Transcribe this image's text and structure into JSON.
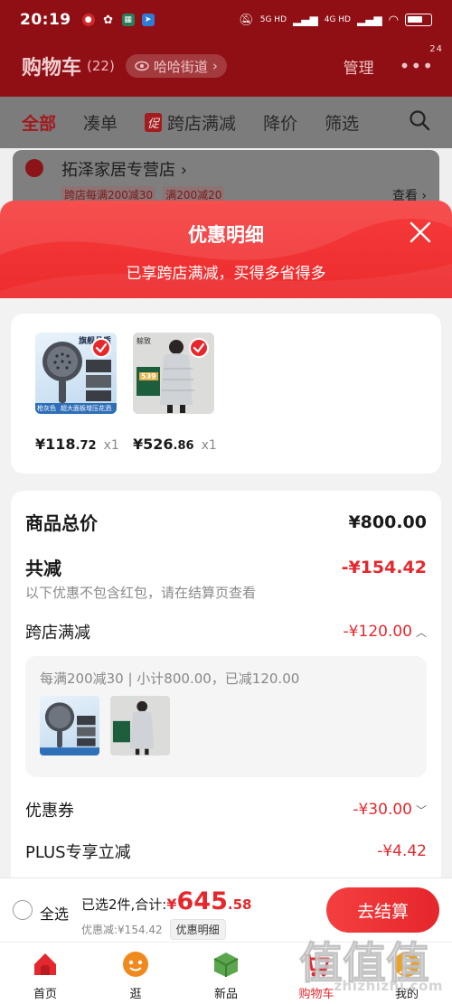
{
  "status_bar": {
    "time": "20:19",
    "network_1": "5G HD",
    "network_2": "4G HD"
  },
  "cart_header": {
    "title": "购物车",
    "count": "(22)",
    "address": "哈哈街道",
    "manage": "管理",
    "more_badge": "24"
  },
  "tabs": [
    "全部",
    "凑单",
    "跨店满减",
    "降价",
    "筛选"
  ],
  "promo_tag_glyph": "促",
  "store": {
    "name": "拓泽家居专营店",
    "promos": [
      "跨店每满200减30",
      "满200减20"
    ],
    "view": "查看"
  },
  "sheet": {
    "title": "优惠明细",
    "subtitle": "已享跨店满减，买得多省得多"
  },
  "products": [
    {
      "name": "shower-head",
      "price_int": "¥118",
      "price_dec": ".72",
      "qty": "x1",
      "img_tag": "旗舰品质",
      "img_footer_left": "枪灰色",
      "img_footer_right": "超大面板增压花洒"
    },
    {
      "name": "down-jacket",
      "price_int": "¥526",
      "price_dec": ".86",
      "qty": "x1",
      "img_tag": "539",
      "img_brand": "鲸致"
    }
  ],
  "details": {
    "total_label": "商品总价",
    "total_value": "¥800.00",
    "discount_label": "共减",
    "discount_value": "-¥154.42",
    "note": "以下优惠不包含红包，请在结算页查看",
    "cross_store_label": "跨店满减",
    "cross_store_value": "-¥120.00",
    "cross_store_detail": "每满200减30 | 小计800.00，已减120.00",
    "coupon_label": "优惠券",
    "coupon_value": "-¥30.00",
    "plus_label": "PLUS专享立减",
    "plus_value": "-¥4.42"
  },
  "checkout": {
    "select_all": "全选",
    "summary_label": "已选2件,合计:",
    "currency": "¥",
    "total_int": "645",
    "total_dec": ".58",
    "discount_text": "优惠减:¥154.42",
    "discount_button": "优惠明细",
    "button": "去结算"
  },
  "bottom_nav": [
    {
      "label": "首页",
      "icon": "home-icon",
      "color": "#e4282d"
    },
    {
      "label": "逛",
      "icon": "browse-icon",
      "color": "#f08a1e"
    },
    {
      "label": "新品",
      "icon": "new-products-icon",
      "color": "#5aa64c"
    },
    {
      "label": "购物车",
      "icon": "cart-icon",
      "color": "#e4282d"
    },
    {
      "label": "我的",
      "icon": "profile-icon",
      "color": "#f2a11c"
    }
  ],
  "watermark": {
    "glyphs": "值值值",
    "text": "zhizhizhi.com"
  },
  "colors": {
    "accent": "#e4282d",
    "header_dim": "#8f0f14",
    "sheet_gradient_top": "#f63a3a"
  }
}
